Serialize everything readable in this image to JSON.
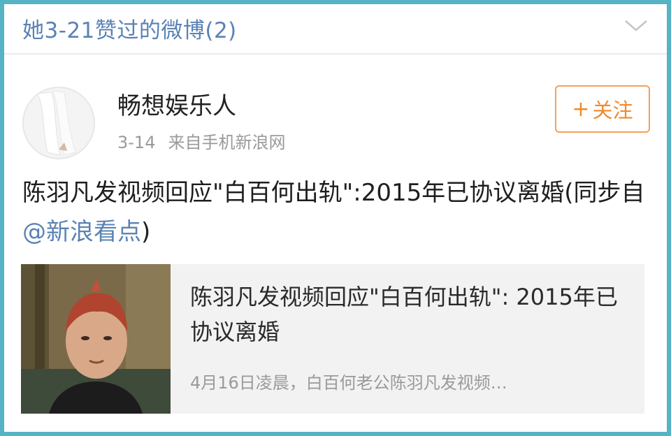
{
  "header": {
    "title": "她3-21赞过的微博(2)",
    "expand_icon": "chevron-down-icon"
  },
  "post": {
    "username": "畅想娱乐人",
    "date": "3-14",
    "source": "来自手机新浪网",
    "follow_label": "关注",
    "follow_plus": "+",
    "text_before_mention": "陈羽凡发视频回应\"白百何出轨\":2015年已协议离婚(同步自",
    "mention": "@新浪看点",
    "text_after_mention": ")",
    "card": {
      "title": "陈羽凡发视频回应\"白百何出轨\": 2015年已协议离婚",
      "description": "4月16日凌晨，白百何老公陈羽凡发视频…"
    }
  },
  "colors": {
    "frame": "#56b3c4",
    "link": "#5a82b5",
    "follow": "#f08a2c"
  }
}
